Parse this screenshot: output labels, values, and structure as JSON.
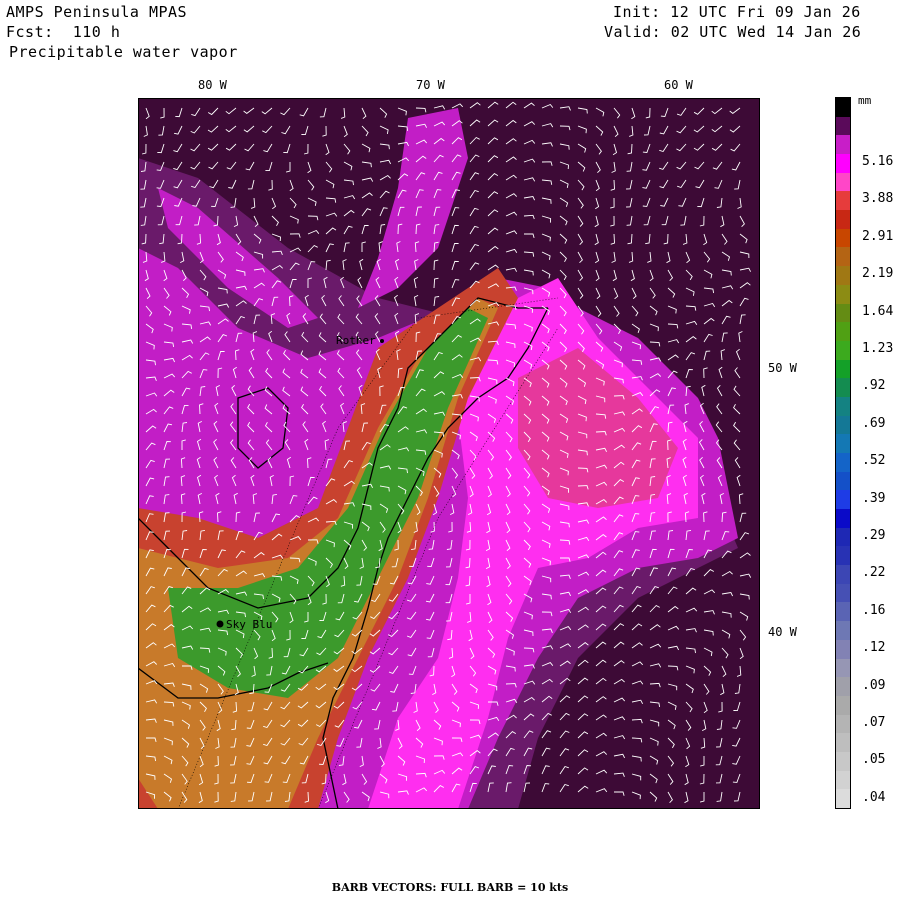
{
  "header": {
    "model": "AMPS Peninsula MPAS",
    "forecast": "Fcst:  110 h",
    "field": "Precipitable water vapor",
    "init": "Init: 12 UTC Fri 09 Jan 26",
    "valid": "Valid: 02 UTC Wed 14 Jan 26"
  },
  "map": {
    "top_longitude_labels": [
      "80 W",
      "70 W",
      "60 W"
    ],
    "side_longitude_labels": [
      "50 W",
      "40 W"
    ],
    "stations": [
      {
        "name": "Rother"
      },
      {
        "name": "Sky Blu"
      }
    ],
    "colors": {
      "background": "#3d0a36",
      "dry_purple": "#6a1a6a",
      "magenta": "#c21ec6",
      "bright_magenta": "#ff2ef0",
      "pink": "#e6389c",
      "red": "#c8422f",
      "orange": "#c87a2a",
      "olive": "#9a9a28",
      "green": "#3c9a2c",
      "coast": "#000000",
      "barb": "#ffffff"
    }
  },
  "colorbar": {
    "unit": "mm",
    "labels": [
      "5.16",
      "3.88",
      "2.91",
      "2.19",
      "1.64",
      "1.23",
      ".92",
      ".69",
      ".52",
      ".39",
      ".29",
      ".22",
      ".16",
      ".12",
      ".09",
      ".07",
      ".05",
      ".04"
    ],
    "colors": [
      "#000000",
      "#5a0a5a",
      "#c81ec8",
      "#ff00ff",
      "#ff46c8",
      "#e63c3c",
      "#c82814",
      "#c84600",
      "#b46414",
      "#a07814",
      "#8c8c14",
      "#648c14",
      "#50a014",
      "#3caa1e",
      "#14a028",
      "#148c50",
      "#148282",
      "#147896",
      "#1478b4",
      "#1464c8",
      "#1450c8",
      "#1e3ce6",
      "#0a0ac8",
      "#1e28b4",
      "#2832b4",
      "#3c46b4",
      "#4650b4",
      "#5a64b4",
      "#6e78b4",
      "#8282b4",
      "#9696b4",
      "#a0a0aa",
      "#aaaaaa",
      "#b4b4b4",
      "#bebebe",
      "#c8c8c8",
      "#d2d2d2",
      "#dcdcdc"
    ]
  },
  "footer": "BARB VECTORS:  FULL BARB = 10 kts"
}
